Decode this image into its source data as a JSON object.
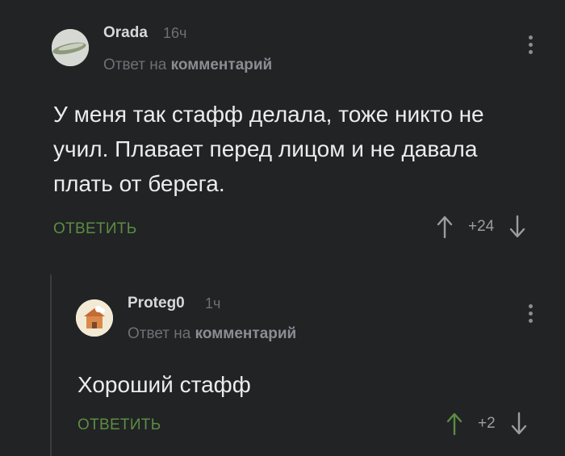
{
  "comments": [
    {
      "username": "Orada",
      "time": "16ч",
      "reply_prefix": "Ответ на",
      "reply_target": "комментарий",
      "text": "У меня так стафф делала, тоже никто не учил. Плавает перед лицом и не давала плать от берега.",
      "reply_label": "ОТВЕТИТЬ",
      "score": "+24",
      "upvote_color": "#9a9ea2",
      "downvote_color": "#9a9ea2"
    },
    {
      "username": "Proteg0",
      "time": "1ч",
      "reply_prefix": "Ответ на",
      "reply_target": "комментарий",
      "text": "Хороший стафф",
      "reply_label": "ОТВЕТИТЬ",
      "score": "+2",
      "upvote_color": "#5d8c43",
      "downvote_color": "#9a9ea2"
    }
  ],
  "colors": {
    "background": "#212325",
    "accent_green": "#5d8c43",
    "muted": "#6d7175"
  }
}
